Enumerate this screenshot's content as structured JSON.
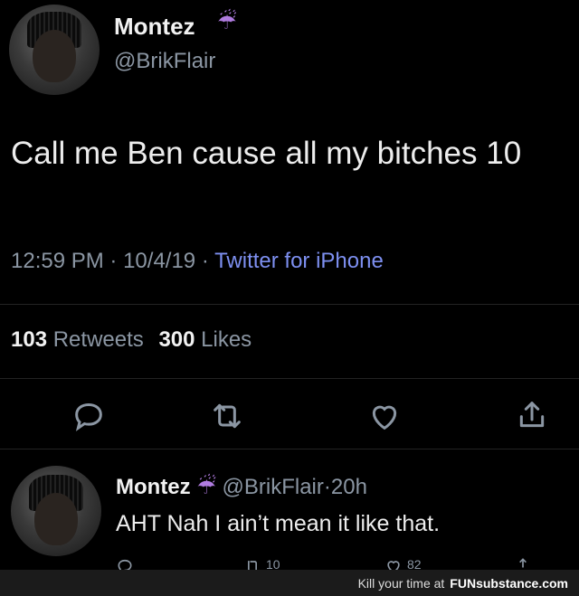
{
  "tweet": {
    "author_name": "Montez",
    "author_emoji": "☔",
    "handle": "@BrikFlair",
    "text": "Call me Ben cause all my bitches 10",
    "time": "12:59 PM",
    "date": "10/4/19",
    "separator": "·",
    "source": "Twitter for iPhone",
    "retweets_count": "103",
    "retweets_label": "Retweets",
    "likes_count": "300",
    "likes_label": "Likes"
  },
  "actions": {
    "reply_icon": "reply-icon",
    "retweet_icon": "retweet-icon",
    "like_icon": "heart-icon",
    "share_icon": "share-icon"
  },
  "reply": {
    "author_name": "Montez",
    "author_emoji": "☔",
    "handle": "@BrikFlair",
    "age": "20h",
    "separator": "·",
    "text": "AHT Nah I ain’t mean it like that.",
    "retweets_count": "10",
    "likes_count": "82"
  },
  "footer": {
    "tagline": "Kill your time at",
    "brand": "FUNsubstance.com"
  },
  "colors": {
    "background": "#000000",
    "link": "#7d8ff0",
    "muted": "#8b96a3"
  }
}
